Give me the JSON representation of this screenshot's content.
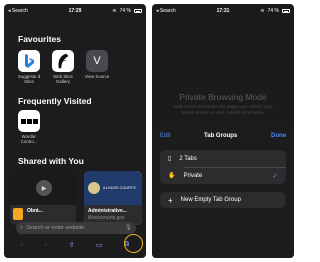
{
  "left": {
    "status": {
      "carrier": "◂ Search",
      "time": "17:29",
      "battery": "74 %"
    },
    "favourites": {
      "title": "Favourites",
      "items": [
        {
          "label": "Suggeste d Sites",
          "icon": "bing-icon",
          "bg": "#ffffff"
        },
        {
          "label": "Web Slice Gallery",
          "icon": "feather-icon",
          "bg": "#ffffff"
        },
        {
          "label": "View Source",
          "icon": "v-icon",
          "bg": "#4a4a4e"
        }
      ]
    },
    "frequently_visited": {
      "title": "Frequently Visited",
      "items": [
        {
          "label": "Wordle: Contro...",
          "icon": "bbc-icon"
        }
      ]
    },
    "shared": {
      "title": "Shared with You",
      "cards": [
        {
          "title": "Obrá...",
          "subtitle": ""
        },
        {
          "title": "Administrative...",
          "subtitle": "illinoiscourts.gov",
          "image_text": "ILLINOIS COURTS"
        }
      ]
    },
    "search": {
      "placeholder": "Search or enter website"
    }
  },
  "right": {
    "status": {
      "carrier": "◂ Search",
      "time": "17:31",
      "battery": "74 %"
    },
    "private_mode": {
      "title": "Private Browsing Mode",
      "subtitle": "Safari won't remember the pages you visited, your search history or your AutoFill information."
    },
    "sheet": {
      "edit": "Edit",
      "title": "Tab Groups",
      "done": "Done",
      "groups": [
        {
          "label": "2 Tabs",
          "selected": false
        },
        {
          "label": "Private",
          "selected": true
        }
      ],
      "new_group": "New Empty Tab Group"
    }
  },
  "colors": {
    "accent": "#4b8cff",
    "highlight": "#f0b323"
  }
}
